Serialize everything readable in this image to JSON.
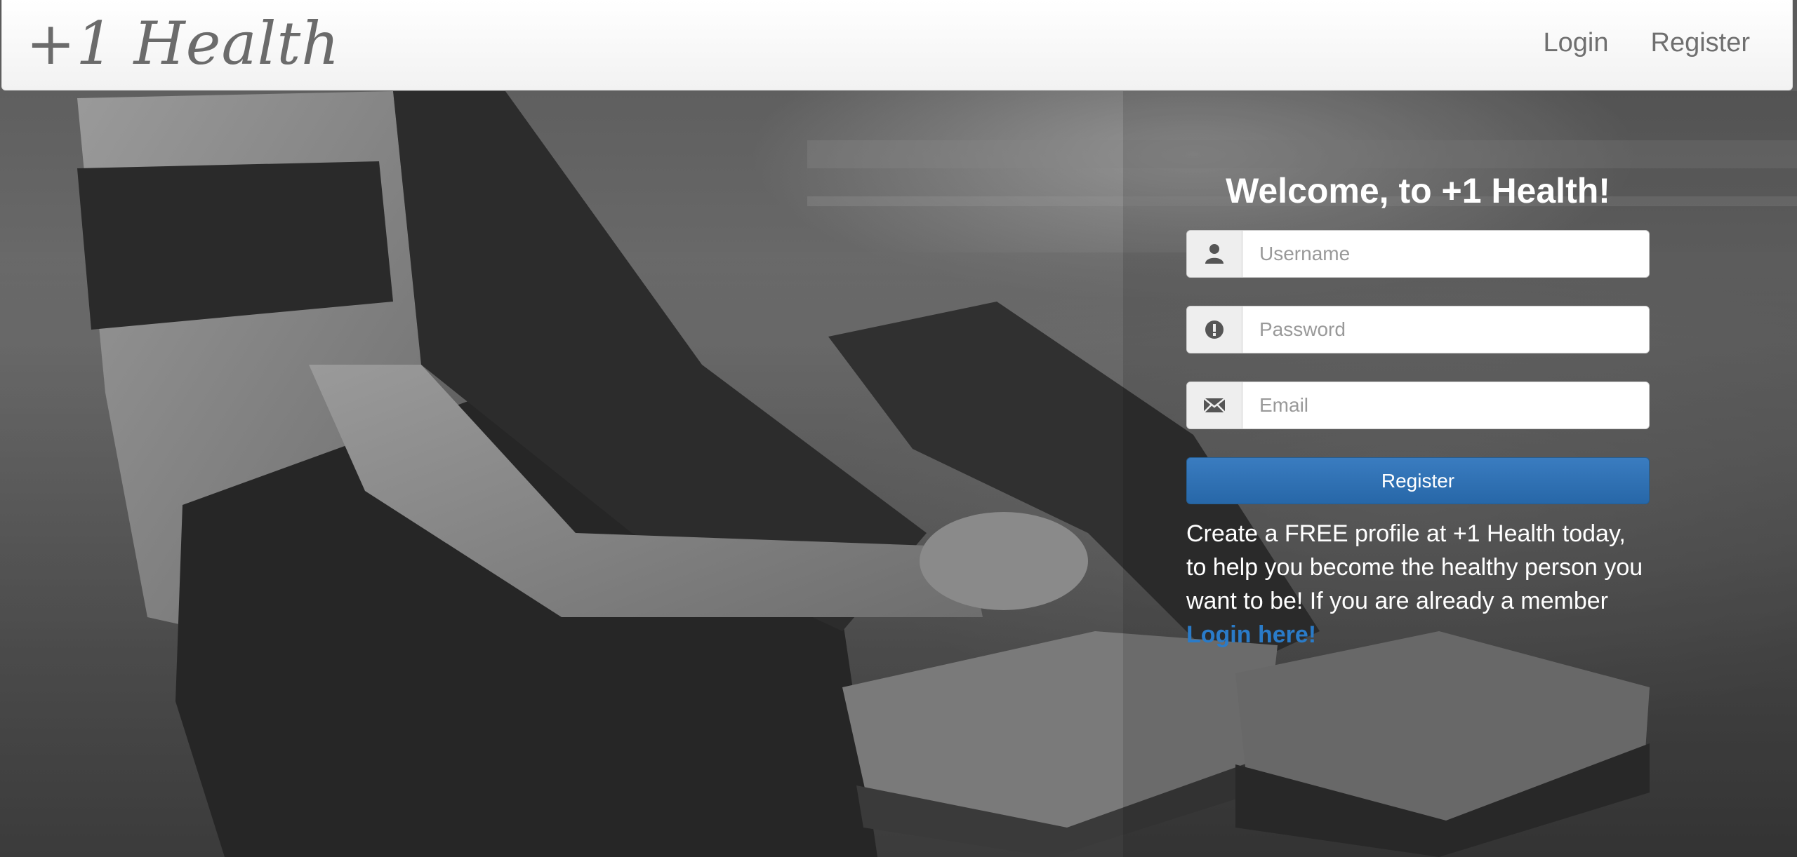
{
  "navbar": {
    "brand": "+1 Health",
    "links": [
      {
        "label": "Login"
      },
      {
        "label": "Register"
      }
    ]
  },
  "hero": {
    "image_description_icon": "runner-tying-shoe-photo"
  },
  "form": {
    "title": "Welcome, to +1 Health!",
    "fields": {
      "username": {
        "placeholder": "Username",
        "icon": "user-icon"
      },
      "password": {
        "placeholder": "Password",
        "icon": "exclamation-circle-icon"
      },
      "email": {
        "placeholder": "Email",
        "icon": "envelope-icon"
      }
    },
    "submit_label": "Register",
    "blurb_text": "Create a FREE profile at +1 Health today, to help you become the healthy person you want to be! If you are already a member ",
    "login_link": "Login here!"
  },
  "colors": {
    "primary": "#2a6cb0",
    "link": "#2a7bc8"
  }
}
